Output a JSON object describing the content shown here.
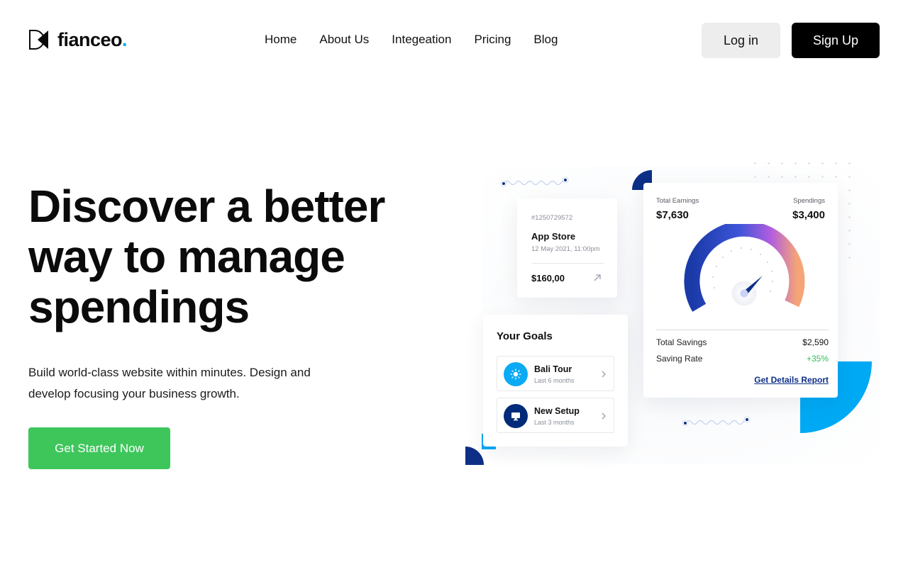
{
  "brand": {
    "name": "fianceo",
    "dot": ".",
    "accent": "#00a9f4"
  },
  "nav": {
    "items": [
      "Home",
      "About Us",
      "Integeation",
      "Pricing",
      "Blog"
    ]
  },
  "auth": {
    "login_label": "Log in",
    "signup_label": "Sign Up"
  },
  "hero": {
    "title": "Discover a better way to manage spendings",
    "subtitle": "Build world-class website within minutes. Design and develop focusing your business growth.",
    "cta_label": "Get Started Now",
    "cta_color": "#3ec65b"
  },
  "transaction": {
    "id": "#1250729572",
    "name": "App Store",
    "date": "12 May 2021, 11:00pm",
    "amount": "$160,00",
    "icon": "arrow-up-right-icon"
  },
  "goals": {
    "title": "Your Goals",
    "items": [
      {
        "name": "Bali Tour",
        "sub": "Last 6 months",
        "icon": "sun-icon",
        "color": "#0aaaf4"
      },
      {
        "name": "New Setup",
        "sub": "Last 3 months",
        "icon": "monitor-icon",
        "color": "#002b78"
      }
    ]
  },
  "stats": {
    "earnings_label": "Total Earnings",
    "earnings_value": "$7,630",
    "spendings_label": "Spendings",
    "spendings_value": "$3,400",
    "savings_label": "Total Savings",
    "savings_value": "$2,590",
    "rate_label": "Saving Rate",
    "rate_value": "+35%",
    "report_link": "Get Details Report"
  },
  "colors": {
    "navy": "#0d2f86",
    "blue": "#00a9f4",
    "green": "#2fbe5c"
  }
}
